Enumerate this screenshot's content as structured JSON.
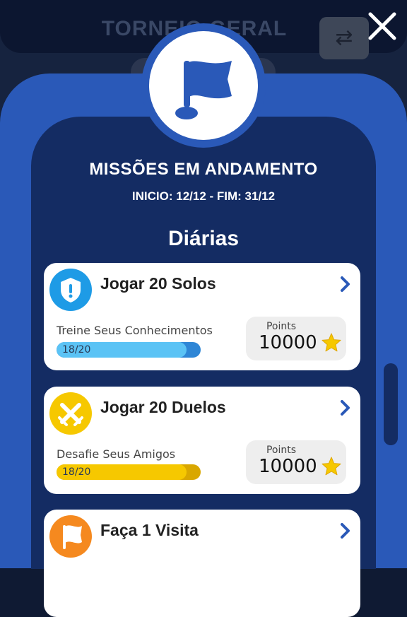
{
  "background": {
    "header_title": "TORNEIO GERAL"
  },
  "modal": {
    "title": "MISSÕES EM ANDAMENTO",
    "dates": "INICIO: 12/12 - FIM: 31/12",
    "section": "Diárias"
  },
  "colors": {
    "modal_outer": "#2a59b8",
    "modal_inner": "#142c63",
    "blue_accent": "#2a59b8",
    "solo_blue": "#1e9be6",
    "duel_yellow": "#f6c800",
    "visit_orange": "#f5891f",
    "progress_blue": "#5bc3f5",
    "progress_yellow": "#f6c800"
  },
  "missions": [
    {
      "title": "Jogar 20 Solos",
      "subtitle": "Treine Seus Conhecimentos",
      "progress_text": "18/20",
      "progress": 0.9,
      "points_label": "Points",
      "points": "10000",
      "icon": "shield-icon"
    },
    {
      "title": "Jogar 20 Duelos",
      "subtitle": "Desafie Seus Amigos",
      "progress_text": "18/20",
      "progress": 0.9,
      "points_label": "Points",
      "points": "10000",
      "icon": "crossed-swords-icon"
    },
    {
      "title": "Faça 1 Visita",
      "icon": "flag-icon"
    }
  ]
}
